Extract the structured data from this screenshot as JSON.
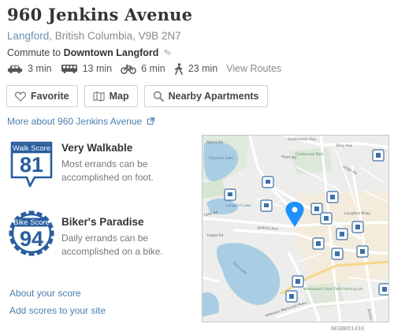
{
  "header": {
    "title": "960 Jenkins Avenue",
    "city": "Langford",
    "rest_address": ", British Columbia, V9B 2N7",
    "commute_prefix": "Commute to",
    "commute_dest": "Downtown Langford"
  },
  "commute_modes": [
    {
      "icon": "car-icon",
      "time": "3 min"
    },
    {
      "icon": "bus-icon",
      "time": "13 min"
    },
    {
      "icon": "bicycle-icon",
      "time": "6 min"
    },
    {
      "icon": "walking-icon",
      "time": "23 min"
    }
  ],
  "view_routes": "View Routes",
  "buttons": {
    "favorite": "Favorite",
    "map": "Map",
    "nearby": "Nearby Apartments"
  },
  "more_about": "More about 960 Jenkins Avenue",
  "walk": {
    "badge_label": "Walk Score",
    "score": "81",
    "title": "Very Walkable",
    "desc": "Most errands can be accomplished on foot."
  },
  "bike": {
    "badge_label": "Bike Score",
    "score": "94",
    "title": "Biker's Paradise",
    "desc": "Daily errands can be accomplished on a bike."
  },
  "links": {
    "about_score": "About your score",
    "add_scores": "Add scores to your site"
  },
  "map": {
    "streets": [
      "Goldstream Ave",
      "Peatt Rd",
      "Jenkins Ave",
      "Langford Pkwy",
      "Leigh Rd",
      "Bray Ave",
      "Hagel Rd",
      "Atkins Rd",
      "Veterans Memorial Pkwy",
      "Jacklin Rd",
      "Lake Rd"
    ],
    "places": [
      "Centennial Park",
      "Langford Lake",
      "Glen Lake",
      "Florence Lake",
      "Westwood Creek Park Parking Lot"
    ],
    "marker_color": "#1e90ff",
    "credit": "NESBRD1433"
  },
  "colors": {
    "accent": "#2a5d9e",
    "link": "#4a7fb0"
  }
}
